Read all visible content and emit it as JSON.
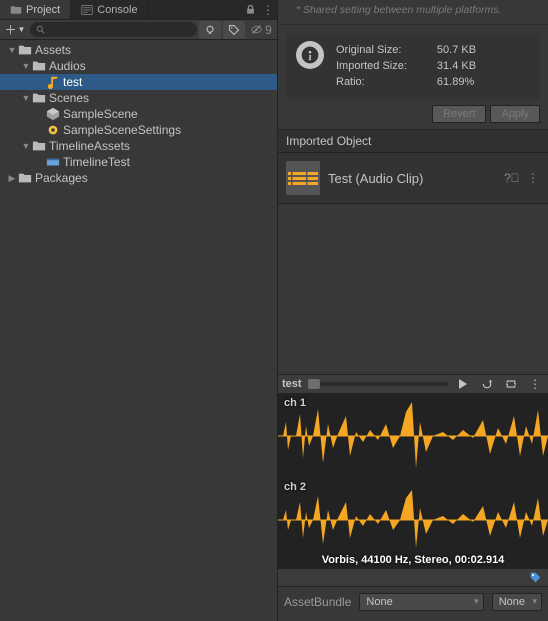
{
  "tabs": {
    "project": "Project",
    "console": "Console"
  },
  "toolbar": {
    "hidden_count": "9"
  },
  "tree": [
    {
      "label": "Assets",
      "indent": 0,
      "icon": "folder",
      "expanded": true
    },
    {
      "label": "Audios",
      "indent": 1,
      "icon": "folder",
      "expanded": true
    },
    {
      "label": "test",
      "indent": 2,
      "icon": "audio",
      "selected": true
    },
    {
      "label": "Scenes",
      "indent": 1,
      "icon": "folder",
      "expanded": true
    },
    {
      "label": "SampleScene",
      "indent": 2,
      "icon": "scene"
    },
    {
      "label": "SampleSceneSettings",
      "indent": 2,
      "icon": "settings"
    },
    {
      "label": "TimelineAssets",
      "indent": 1,
      "icon": "folder",
      "expanded": true
    },
    {
      "label": "TimelineTest",
      "indent": 2,
      "icon": "timeline"
    },
    {
      "label": "Packages",
      "indent": 0,
      "icon": "folder",
      "expanded": false
    }
  ],
  "shared_note": "* Shared setting between multiple platforms.",
  "size": {
    "rows": [
      {
        "k": "Original Size:",
        "v": "50.7 KB"
      },
      {
        "k": "Imported Size:",
        "v": "31.4 KB"
      },
      {
        "k": "Ratio:",
        "v": "61.89%"
      }
    ]
  },
  "buttons": {
    "revert": "Revert",
    "apply": "Apply"
  },
  "imported_header": "Imported Object",
  "clip_name": "Test (Audio Clip)",
  "preview_name": "test",
  "channels": {
    "ch1": "ch 1",
    "ch2": "ch 2"
  },
  "format_line": "Vorbis, 44100 Hz, Stereo, 00:02.914",
  "assetbundle": {
    "label": "AssetBundle",
    "value": "None",
    "variant": "None"
  }
}
